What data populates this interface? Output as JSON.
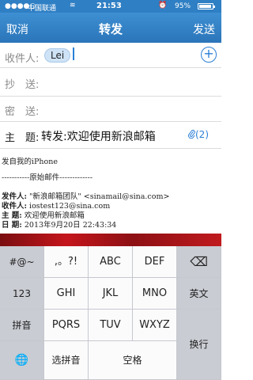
{
  "status": {
    "signal": "●●●●○",
    "carrier": "中国联通",
    "wifi": "≋",
    "time": "21:53",
    "alarm": "⏰",
    "battery_text": "95%",
    "battery_level": 0.95
  },
  "nav": {
    "cancel": "取消",
    "title": "转发",
    "send": "发送"
  },
  "to": {
    "label": "收件人:",
    "recipient": "Lei",
    "add": "+"
  },
  "cc": {
    "label": "抄　送:"
  },
  "bcc": {
    "label": "密　送:"
  },
  "subject": {
    "label": "主　题:",
    "value": "转发:欢迎使用新浪邮箱",
    "attachment": "(2)",
    "attach_icon": "paperclip-icon"
  },
  "body": {
    "line1": "发自我的iPhone",
    "line2": "-----------原始邮件-------------",
    "from_label": "发件人:",
    "from_value": "\"新浪邮箱团队\" <sinamail@sina.com>",
    "to_label": "收件人:",
    "to_value": "iostest123@sina.com",
    "subject_label": "主 题:",
    "subject_value": "欢迎使用新浪邮箱",
    "date_label": "日 期:",
    "date_value": "2013年9月20日 22:43:34"
  },
  "keyboard": {
    "row1": [
      "#@~",
      ",。?!",
      "ABC",
      "DEF"
    ],
    "row2": [
      "123",
      "GHI",
      "JKL",
      "MNO",
      "英文"
    ],
    "row3": [
      "拼音",
      "PQRS",
      "TUV",
      "WXYZ",
      "换行"
    ],
    "row4": [
      "选拼音",
      "空格"
    ],
    "delete": "⌫",
    "globe": "🌐"
  },
  "colors": {
    "nav": "#2b75b9",
    "accent": "#2b7fd6",
    "keyboard": "#d6d9de"
  }
}
